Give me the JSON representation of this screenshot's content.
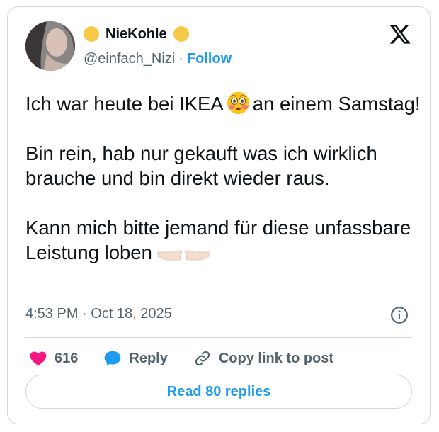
{
  "author": {
    "display_name": "NieKohle",
    "handle": "@einfach_Nizi",
    "separator": "·",
    "follow_label": "Follow"
  },
  "tweet": {
    "line1_before": "Ich war heute bei IKEA",
    "line1_after": "an einem Samstag!",
    "paragraph2": "Bin rein, hab nur gekauft was ich wirklich brauche und bin direkt wieder raus.",
    "paragraph3": "Kann mich bitte jemand für diese unfassbare Leistung loben",
    "timestamp": "4:53 PM · Oct 18, 2025"
  },
  "actions": {
    "like_count": "616",
    "reply_label": "Reply",
    "copy_link_label": "Copy link to post"
  },
  "footer": {
    "read_replies_label": "Read 80 replies"
  },
  "colors": {
    "accent": "#1d9bf0",
    "like": "#f91880",
    "muted": "#536471",
    "border": "#cfd9de",
    "badge": "#f7c948"
  },
  "icons": {
    "logo": "x-logo-icon",
    "emoji": "flushed-face-icon",
    "hands": "pointing-fingers-icon",
    "info": "info-icon",
    "like": "heart-icon",
    "reply": "speech-bubble-icon",
    "copy": "link-icon"
  }
}
